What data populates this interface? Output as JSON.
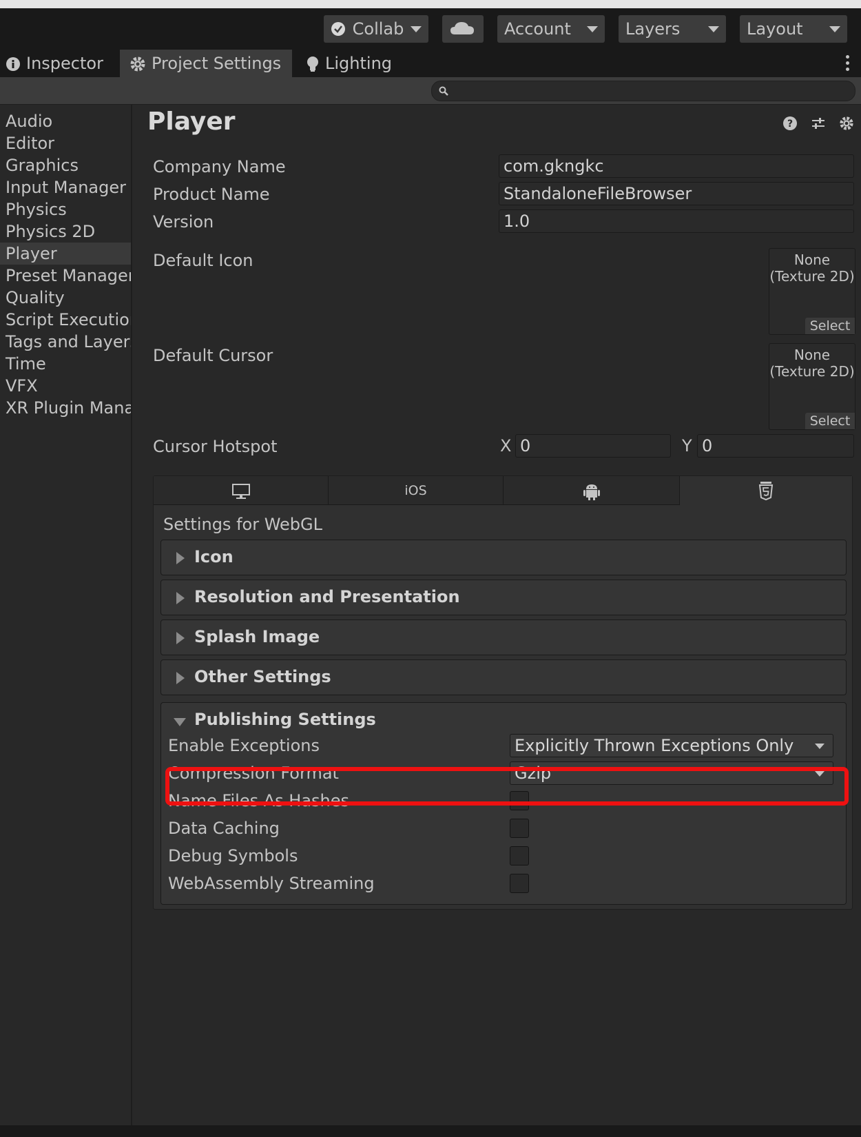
{
  "toolbar": {
    "collab_label": "Collab",
    "account_label": "Account",
    "layers_label": "Layers",
    "layout_label": "Layout"
  },
  "tabs": [
    {
      "label": "Inspector",
      "icon": "info-icon"
    },
    {
      "label": "Project Settings",
      "icon": "gear-icon",
      "active": true
    },
    {
      "label": "Lighting",
      "icon": "lightbulb-icon"
    }
  ],
  "search": {
    "placeholder": ""
  },
  "sidebar": {
    "items": [
      {
        "label": "Audio"
      },
      {
        "label": "Editor"
      },
      {
        "label": "Graphics"
      },
      {
        "label": "Input Manager"
      },
      {
        "label": "Physics"
      },
      {
        "label": "Physics 2D"
      },
      {
        "label": "Player",
        "selected": true
      },
      {
        "label": "Preset Manager"
      },
      {
        "label": "Quality"
      },
      {
        "label": "Script Execution"
      },
      {
        "label": "Tags and Layers"
      },
      {
        "label": "Time"
      },
      {
        "label": "VFX"
      },
      {
        "label": "XR Plugin Manag"
      }
    ]
  },
  "player": {
    "title": "Player",
    "company_name_label": "Company Name",
    "company_name_value": "com.gkngkc",
    "product_name_label": "Product Name",
    "product_name_value": "StandaloneFileBrowser",
    "version_label": "Version",
    "version_value": "1.0",
    "default_icon_label": "Default Icon",
    "default_icon_value_line1": "None",
    "default_icon_value_line2": "(Texture 2D)",
    "default_cursor_label": "Default Cursor",
    "default_cursor_value_line1": "None",
    "default_cursor_value_line2": "(Texture 2D)",
    "select_label": "Select",
    "cursor_hotspot_label": "Cursor Hotspot",
    "x_label": "X",
    "x_value": "0",
    "y_label": "Y",
    "y_value": "0"
  },
  "platform_tabs": [
    {
      "label": "",
      "icon": "monitor-icon"
    },
    {
      "label": "iOS",
      "icon": ""
    },
    {
      "label": "",
      "icon": "android-icon"
    },
    {
      "label": "",
      "icon": "html5-icon",
      "active": true
    }
  ],
  "webgl": {
    "settings_for": "Settings for WebGL",
    "sections": [
      {
        "title": "Icon"
      },
      {
        "title": "Resolution and Presentation"
      },
      {
        "title": "Splash Image"
      },
      {
        "title": "Other Settings"
      }
    ],
    "publishing": {
      "title": "Publishing Settings",
      "enable_exceptions_label": "Enable Exceptions",
      "enable_exceptions_value": "Explicitly Thrown Exceptions Only",
      "compression_format_label": "Compression Format",
      "compression_format_value": "Gzip",
      "name_files_label": "Name Files As Hashes",
      "data_caching_label": "Data Caching",
      "debug_symbols_label": "Debug Symbols",
      "wasm_streaming_label": "WebAssembly Streaming"
    }
  },
  "colors": {
    "highlight": "#ee1111",
    "background": "#282828",
    "toolbar": "#191919"
  }
}
